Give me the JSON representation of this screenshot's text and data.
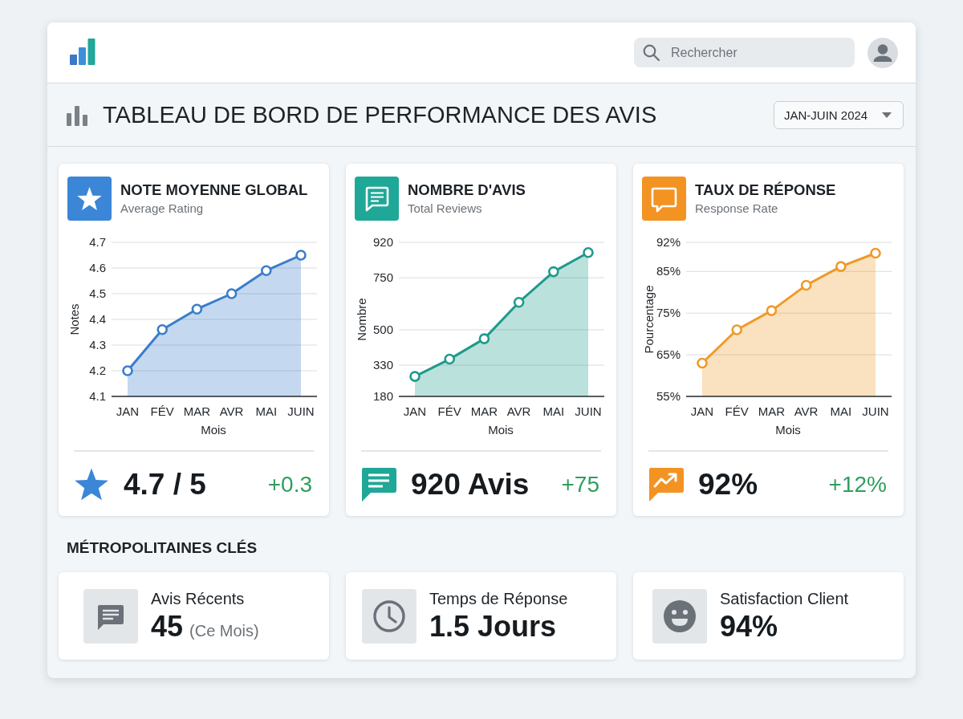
{
  "top_bar": {
    "search": {
      "placeholder": "Rechercher"
    }
  },
  "header": {
    "title": "TABLEAU DE BORD DE PERFORMANCE DES AVIS",
    "period": {
      "value": "JAN-JUIN 2024"
    }
  },
  "metric_cards": [
    {
      "kind": "rating",
      "title": "NOTE MOYENNE GLOBAL",
      "subtitle": "Average Rating",
      "color": "#3b86d6",
      "chart_data": {
        "type": "area",
        "xlabel": "Mois",
        "ylabel": "Notes",
        "categories": [
          "JAN",
          "FÉV",
          "MAR",
          "AVR",
          "MAI",
          "JUIN"
        ],
        "series": [
          {
            "color": "#3a7dc9",
            "values": [
              4.2,
              4.36,
              4.44,
              4.5,
              4.59,
              4.65
            ]
          }
        ],
        "ylim": [
          4.1,
          4.7
        ],
        "yticks": [
          4.1,
          4.2,
          4.3,
          4.4,
          4.5,
          4.6,
          4.7
        ],
        "grid": true
      },
      "summary": {
        "value": "4.7 / 5",
        "change": "+0.3"
      }
    },
    {
      "kind": "reviews",
      "title": "NOMBRE D'AVIS",
      "subtitle": "Total Reviews",
      "color": "#1fa797",
      "chart_data": {
        "type": "area",
        "xlabel": "Mois",
        "ylabel": "Nombre",
        "categories": [
          "JAN",
          "FÉV",
          "MAR",
          "AVR",
          "MAI",
          "JUIN"
        ],
        "series": [
          {
            "color": "#1f9a8c",
            "values": [
              276,
              359,
              457,
              632,
              779,
              871
            ]
          }
        ],
        "ylim": [
          180,
          920
        ],
        "yticks": [
          180,
          330,
          500,
          750,
          920
        ],
        "grid": true
      },
      "summary": {
        "value": "920 Avis",
        "change": "+75"
      }
    },
    {
      "kind": "response",
      "title": "TAUX DE RÉPONSE",
      "subtitle": "Response Rate",
      "color": "#f39322",
      "chart_data": {
        "type": "area",
        "xlabel": "Mois",
        "ylabel": "Pourcentage",
        "categories": [
          "JAN",
          "FÉV",
          "MAR",
          "AVR",
          "MAI",
          "JUIN"
        ],
        "series": [
          {
            "color": "#ee9a2b",
            "values": [
              63,
              71,
              75.6,
              81.7,
              86.2,
              89.4
            ]
          }
        ],
        "ylim": [
          55,
          92
        ],
        "yticks": [
          {
            "value": 55,
            "label": "55%"
          },
          {
            "value": 65,
            "label": "65%"
          },
          {
            "value": 75,
            "label": "75%"
          },
          {
            "value": 85,
            "label": "85%"
          },
          {
            "value": 92,
            "label": "92%"
          }
        ],
        "grid": true
      },
      "summary": {
        "value": "92%",
        "change": "+12%"
      }
    }
  ],
  "key_metrics": {
    "title": "MÉTROPOLITAINES CLÉS",
    "items": [
      {
        "kind": "reviews",
        "label": "Avis Récents",
        "value": "45",
        "note": "(Ce Mois)"
      },
      {
        "kind": "time",
        "label": "Temps de Réponse",
        "value": "1.5 Jours"
      },
      {
        "kind": "satisfaction",
        "label": "Satisfaction Client",
        "value": "94%"
      }
    ]
  }
}
